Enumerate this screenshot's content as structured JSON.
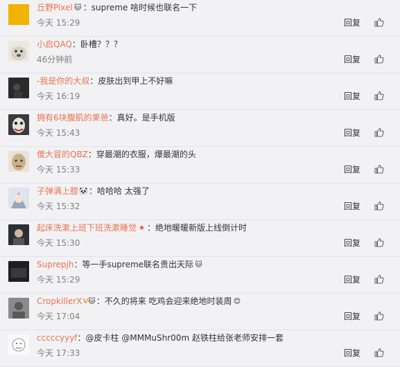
{
  "actions": {
    "reply_label": "回复"
  },
  "comments": [
    {
      "user": "丘野Pixel",
      "badge": "🐱",
      "text": "：supreme 啥时候也联名一下",
      "time": "今天 15:29",
      "avatar": "yellow-avatar",
      "avatar_color": "#f2b300"
    },
    {
      "user": "小启QAQ",
      "badge": "",
      "text": "：卧槽？？？",
      "time": "46分钟前",
      "avatar": "doge-avatar",
      "avatar_color": "#d8d2c4"
    },
    {
      "user": "-我是你的大叔",
      "badge": "",
      "text": "：皮肤出到甲上不好嘛",
      "time": "今天 16:19",
      "avatar": "dark-avatar",
      "avatar_color": "#2a2a2a"
    },
    {
      "user": "拥有6块腹肌的果爸",
      "badge": "",
      "text": "：真好。是手机版",
      "time": "今天 15:43",
      "avatar": "joker-avatar",
      "avatar_color": "#3a3a3a"
    },
    {
      "user": "傻大冒的QBZ",
      "badge": "",
      "text": "：穿最潮的衣服，爆最潮的头",
      "time": "今天 15:33",
      "avatar": "face-avatar",
      "avatar_color": "#c9b08a"
    },
    {
      "user": "子弹满上膛",
      "badge": "🐼",
      "text": "：哈哈哈 太强了",
      "time": "今天 15:32",
      "avatar": "anime-avatar",
      "avatar_color": "#9aa6bd"
    },
    {
      "user": "起床洗漱上班下班洗漱睡觉",
      "badge": "★",
      "text": "：绝地暖暖新版上线倒计时",
      "time": "今天 15:30",
      "avatar": "night-avatar",
      "avatar_color": "#2b2e34"
    },
    {
      "user": "Suprepjh",
      "badge": "",
      "text": "：等一手supreme联名贵出天际",
      "time": "今天 15:29",
      "avatar": "shadow-avatar",
      "avatar_color": "#1f1f1f",
      "trail": "🐱"
    },
    {
      "user": "CropkillerX",
      "badge": "V🐱",
      "text": "：不久的将来 吃鸡会迎来绝地时装周",
      "time": "今天 17:04",
      "avatar": "gray-avatar",
      "avatar_color": "#5a5a5a",
      "trail": "😊"
    },
    {
      "user": "cccccyyyf",
      "badge": "",
      "text": "：@皮卡柱 @MMMuShr00m 赵铁柱给张老师安排一套",
      "time": "今天 17:33",
      "avatar": "sketch-avatar",
      "avatar_color": "#e6e6e6"
    }
  ]
}
